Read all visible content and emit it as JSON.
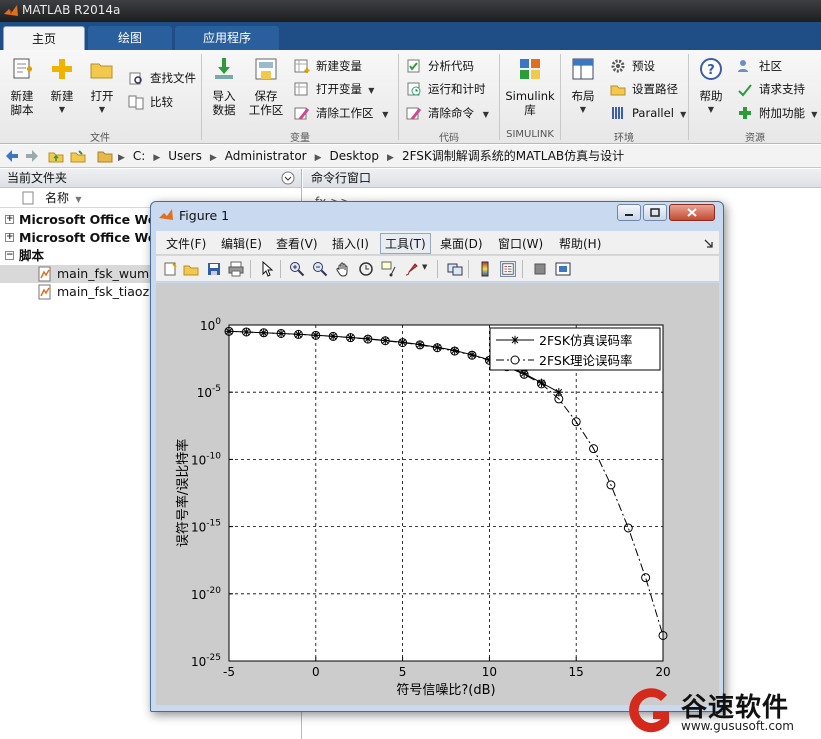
{
  "app": {
    "title": "MATLAB R2014a"
  },
  "tabs": [
    {
      "label": "主页"
    },
    {
      "label": "绘图"
    },
    {
      "label": "应用程序"
    }
  ],
  "ribbon": {
    "file": {
      "new_script": [
        "新建",
        "脚本"
      ],
      "new": "新建",
      "open": "打开",
      "find_files": "查找文件",
      "compare": "比较",
      "group": "文件"
    },
    "variable": {
      "import": [
        "导入",
        "数据"
      ],
      "save": [
        "保存",
        "工作区"
      ],
      "new_var": "新建变量",
      "open_var": "打开变量",
      "clear_ws": "清除工作区",
      "group": "变量"
    },
    "code": {
      "analyze": "分析代码",
      "run_time": "运行和计时",
      "clear_cmd": "清除命令",
      "group": "代码"
    },
    "simulink": {
      "label": [
        "Simulink",
        "库"
      ],
      "group": "SIMULINK"
    },
    "env": {
      "layout": "布局",
      "prefs": "预设",
      "set_path": "设置路径",
      "parallel": "Parallel",
      "group": "环境"
    },
    "resources": {
      "help": "帮助",
      "community": "社区",
      "support": "请求支持",
      "addons": "附加功能",
      "group": "资源"
    }
  },
  "path": [
    "C:",
    "Users",
    "Administrator",
    "Desktop",
    "2FSK调制解调系统的MATLAB仿真与设计"
  ],
  "left_panel": {
    "title": "当前文件夹",
    "col_name": "名称",
    "items": [
      {
        "label": "Microsoft Office Wor",
        "type": "folder"
      },
      {
        "label": "Microsoft Office Wor",
        "type": "folder"
      },
      {
        "label": "脚本",
        "type": "group"
      },
      {
        "label": "main_fsk_wumal",
        "type": "file"
      },
      {
        "label": "main_fsk_tiaozhi",
        "type": "file"
      }
    ]
  },
  "command_window": {
    "title": "命令行窗口",
    "prompt": "fx >>"
  },
  "figure": {
    "title": "Figure 1",
    "menu": [
      "文件(F)",
      "编辑(E)",
      "查看(V)",
      "插入(I)",
      "工具(T)",
      "桌面(D)",
      "窗口(W)",
      "帮助(H)"
    ]
  },
  "chart_data": {
    "type": "line",
    "title": "",
    "xlabel": "符号信噪比?(dB)",
    "ylabel": "误符号率/误比特率",
    "yscale": "log",
    "xlim": [
      -5,
      20
    ],
    "ylim": [
      1e-25,
      1
    ],
    "xticks": [
      -5,
      0,
      5,
      10,
      15,
      20
    ],
    "yticks": [
      "10^0",
      "10^-5",
      "10^-10",
      "10^-15",
      "10^-20",
      "10^-25"
    ],
    "grid": true,
    "legend_position": "top-right",
    "series": [
      {
        "name": "2FSK仿真误码率",
        "marker": "star",
        "line": "solid",
        "x": [
          -5,
          -4,
          -3,
          -2,
          -1,
          0,
          1,
          2,
          3,
          4,
          5,
          6,
          7,
          8,
          9,
          10,
          11,
          12,
          13,
          14
        ],
        "log10_y": [
          -0.47,
          -0.52,
          -0.58,
          -0.63,
          -0.69,
          -0.76,
          -0.84,
          -0.93,
          -1.03,
          -1.15,
          -1.28,
          -1.45,
          -1.66,
          -1.9,
          -2.22,
          -2.6,
          -3.05,
          -3.6,
          -4.3,
          -5.0
        ]
      },
      {
        "name": "2FSK理论误码率",
        "marker": "circle",
        "line": "dashdot",
        "x": [
          -5,
          -4,
          -3,
          -2,
          -1,
          0,
          1,
          2,
          3,
          4,
          5,
          6,
          7,
          8,
          9,
          10,
          11,
          12,
          13,
          14,
          15,
          16,
          17,
          18,
          19,
          20
        ],
        "log10_y": [
          -0.47,
          -0.52,
          -0.58,
          -0.63,
          -0.7,
          -0.77,
          -0.85,
          -0.94,
          -1.05,
          -1.17,
          -1.31,
          -1.48,
          -1.69,
          -1.94,
          -2.25,
          -2.63,
          -3.1,
          -3.67,
          -4.38,
          -5.5,
          -7.2,
          -9.2,
          -11.9,
          -15.1,
          -18.8,
          -23.1
        ]
      }
    ]
  },
  "watermark": {
    "text": "谷速软件",
    "url": "www.gususoft.com"
  },
  "colors": {
    "tab_bar": "#1f4e86",
    "ribbon": "#efefef",
    "figure_frame": "#c9daf0",
    "plot_bg": "#cccccc",
    "watermark_red": "#d42a1e"
  }
}
